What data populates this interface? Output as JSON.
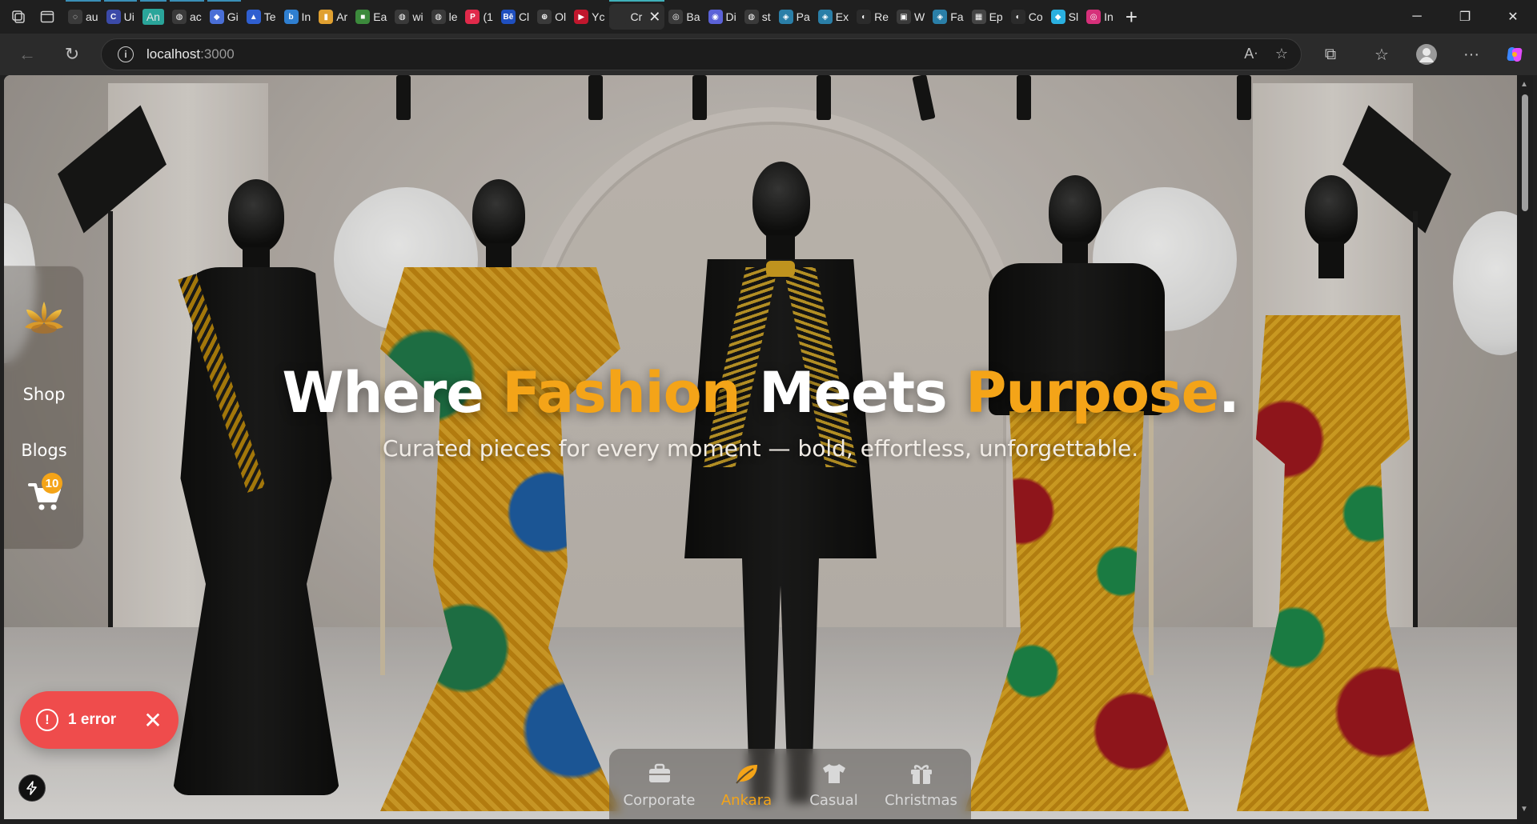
{
  "browser": {
    "tabs": [
      {
        "label": "au",
        "color": "#3a3a3a",
        "glyph": "◌"
      },
      {
        "label": "Ui",
        "color": "#3b4aa8",
        "glyph": "C"
      },
      {
        "label": "An",
        "color": "#2aa59a",
        "glyph": "",
        "highlight": true
      },
      {
        "label": "ac",
        "color": "#3a3a3a",
        "glyph": "◍"
      },
      {
        "label": "Gi",
        "color": "#4a6fd6",
        "glyph": "◆"
      },
      {
        "label": "Te",
        "color": "#2f5fd0",
        "glyph": "▲"
      },
      {
        "label": "In",
        "color": "#2f7fd0",
        "glyph": "b"
      },
      {
        "label": "Ar",
        "color": "#e0a030",
        "glyph": "▮"
      },
      {
        "label": "Ea",
        "color": "#3c8a3c",
        "glyph": "■"
      },
      {
        "label": "wi",
        "color": "#3a3a3a",
        "glyph": "◍"
      },
      {
        "label": "le",
        "color": "#3a3a3a",
        "glyph": "◍"
      },
      {
        "label": "(1",
        "color": "#e02a4a",
        "glyph": "P"
      },
      {
        "label": "Cl",
        "color": "#1f4fbf",
        "glyph": "Bē"
      },
      {
        "label": "Ol",
        "color": "#3a3a3a",
        "glyph": "⊕"
      },
      {
        "label": "Yc",
        "color": "#c0172d",
        "glyph": "▶"
      },
      {
        "label": "Cr",
        "color": "#2e2e2e",
        "glyph": "",
        "active": true
      },
      {
        "label": "Ba",
        "color": "#3a3a3a",
        "glyph": "◎"
      },
      {
        "label": "Di",
        "color": "#5b62d8",
        "glyph": "◉"
      },
      {
        "label": "st",
        "color": "#3a3a3a",
        "glyph": "◍"
      },
      {
        "label": "Pa",
        "color": "#2a7fa8",
        "glyph": "◈"
      },
      {
        "label": "Ex",
        "color": "#2a7fa8",
        "glyph": "◈"
      },
      {
        "label": "Re",
        "color": "#2b2b2b",
        "glyph": "◐"
      },
      {
        "label": "W",
        "color": "#3a3a3a",
        "glyph": "▣"
      },
      {
        "label": "Fa",
        "color": "#2a7fa8",
        "glyph": "◈"
      },
      {
        "label": "Ep",
        "color": "#444444",
        "glyph": "▦"
      },
      {
        "label": "Co",
        "color": "#2b2b2b",
        "glyph": "◐"
      },
      {
        "label": "Sl",
        "color": "#2ab0e0",
        "glyph": "◆"
      },
      {
        "label": "In",
        "color": "#d6307a",
        "glyph": "◎"
      }
    ],
    "url_host": "localhost",
    "url_port": ":3000"
  },
  "hero": {
    "title_part1": "Where ",
    "title_accent1": "Fashion",
    "title_part2": " Meets ",
    "title_accent2": "Purpose",
    "title_end": ".",
    "subtitle": "Curated pieces for every moment — bold, effortless, unforgettable."
  },
  "sidenav": {
    "items": [
      {
        "label": "Shop"
      },
      {
        "label": "Blogs"
      }
    ],
    "cart_count": "10"
  },
  "error_toast": {
    "label": "1 error"
  },
  "categories": [
    {
      "label": "Corporate",
      "icon": "briefcase-icon"
    },
    {
      "label": "Ankara",
      "icon": "leaf-icon",
      "active": true
    },
    {
      "label": "Casual",
      "icon": "tshirt-icon"
    },
    {
      "label": "Christmas",
      "icon": "gift-icon"
    }
  ],
  "colors": {
    "accent": "#f4a418",
    "error": "#ef4c4c"
  }
}
